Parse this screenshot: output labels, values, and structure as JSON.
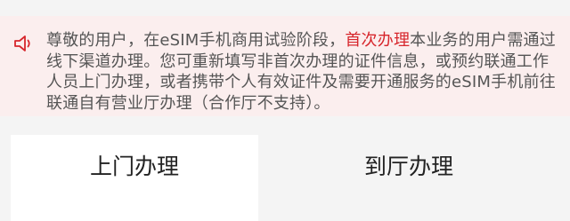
{
  "notice": {
    "icon": "speaker-icon",
    "icon_color": "#d7262c",
    "text_before": "尊敬的用户，在eSIM手机商用试验阶段，",
    "highlight": "首次办理",
    "text_after": "本业务的用户需通过线下渠道办理。您可重新填写非首次办理的证件信息，或预约联通工作人员上门办理，或者携带个人有效证件及需要开通服务的eSIM手机前往联通自有营业厅办理（合作厅不支持）。",
    "highlight_color": "#d7262c"
  },
  "tabs": [
    {
      "label": "上门办理",
      "selected": true
    },
    {
      "label": "到厅办理",
      "selected": false
    }
  ]
}
